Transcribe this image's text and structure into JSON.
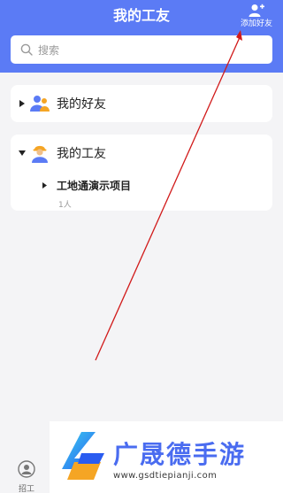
{
  "header": {
    "title": "我的工友",
    "add_friend_label": "添加好友"
  },
  "search": {
    "placeholder": "搜索"
  },
  "groups": [
    {
      "label": "我的好友",
      "expanded": false
    },
    {
      "label": "我的工友",
      "expanded": true,
      "children": [
        {
          "label": "工地通演示项目",
          "count": "1人"
        }
      ]
    }
  ],
  "bottom_nav": {
    "tab_label": "招工"
  },
  "watermark": {
    "brand": "广晟德手游",
    "url": "www.gsdtiepianji.com"
  },
  "colors": {
    "primary": "#5b7bf5",
    "annotation": "#d11a1a"
  }
}
